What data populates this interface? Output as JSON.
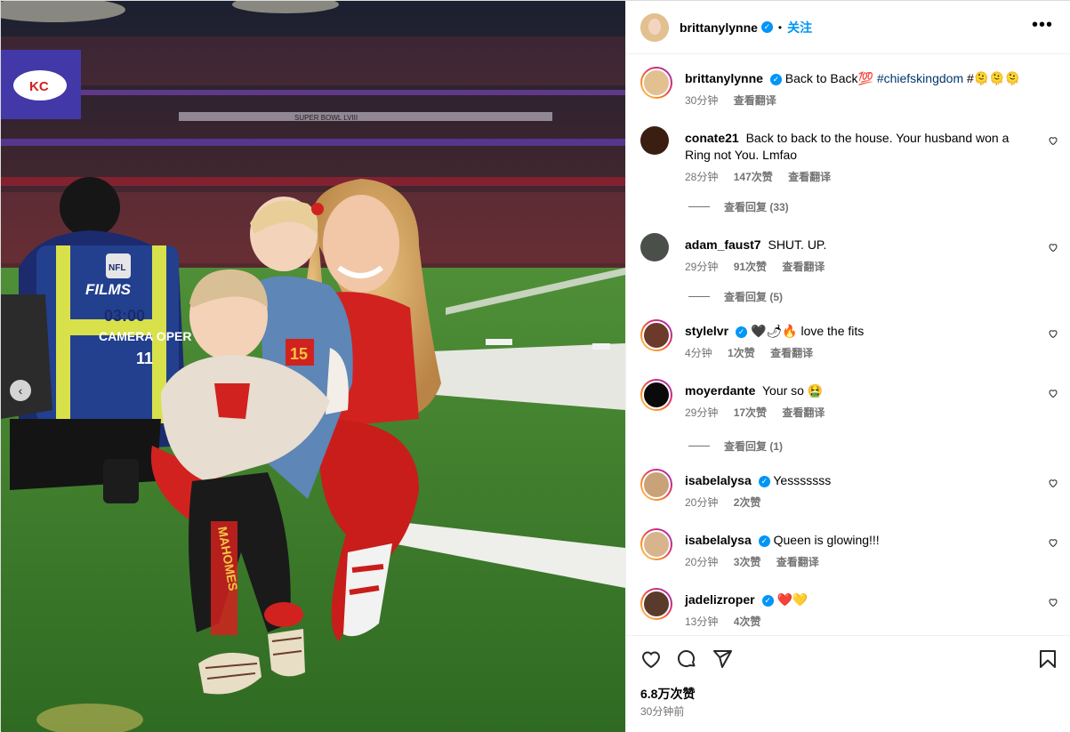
{
  "post": {
    "author": "brittanylynne",
    "follow_label": "关注",
    "more_label": "•••",
    "caption": {
      "text": "Back to Back💯",
      "hashtag": "#chiefskingdom",
      "suffix": "#🫠🫠🫠",
      "time": "30分钟",
      "translate": "查看翻译"
    },
    "likes": "6.8万次赞",
    "posted": "30分钟前"
  },
  "photo": {
    "banner_text": "SUPER BOWL LVIII",
    "vest_line1": "NFL",
    "vest_line2": "FILMS",
    "vest_line3": "03:00",
    "vest_line4": "CAMERA OPER",
    "vest_line5": "11",
    "pants_text": "MAHOMES",
    "jersey_num": "15",
    "prev_arrow": "‹"
  },
  "comments": [
    {
      "user": "conate21",
      "verified": false,
      "text": "Back to back to the house. Your husband won a Ring not You. Lmfao",
      "time": "28分钟",
      "likes": "147次赞",
      "translate": "查看翻译",
      "replies": "查看回复 (33)",
      "avatar_color": "#3a1e12"
    },
    {
      "user": "adam_faust7",
      "verified": false,
      "text": "SHUT. UP.",
      "time": "29分钟",
      "likes": "91次赞",
      "translate": "查看翻译",
      "replies": "查看回复 (5)",
      "avatar_color": "#4b4f4a"
    },
    {
      "user": "stylelvr",
      "verified": true,
      "text": "🖤🌶🔥 love the fits",
      "time": "4分钟",
      "likes": "1次赞",
      "translate": "查看翻译",
      "replies": "",
      "avatar_color": "#6b3a2a"
    },
    {
      "user": "moyerdante",
      "verified": false,
      "text": "Your so 🤮",
      "time": "29分钟",
      "likes": "17次赞",
      "translate": "查看翻译",
      "replies": "查看回复 (1)",
      "avatar_color": "#0a0a0a"
    },
    {
      "user": "isabelalysa",
      "verified": true,
      "text": "Yesssssss",
      "time": "20分钟",
      "likes": "2次赞",
      "translate": "",
      "replies": "",
      "avatar_color": "#c9a27a"
    },
    {
      "user": "isabelalysa",
      "verified": true,
      "text": "Queen is glowing!!!",
      "time": "20分钟",
      "likes": "3次赞",
      "translate": "查看翻译",
      "replies": "",
      "avatar_color": "#d7b48c"
    },
    {
      "user": "jadelizroper",
      "verified": true,
      "text": "❤️💛",
      "time": "13分钟",
      "likes": "4次赞",
      "translate": "",
      "replies": "",
      "avatar_color": "#5a3b2b"
    }
  ],
  "colors": {
    "accent": "#0095f6",
    "chiefs_red": "#d1221f",
    "field_green": "#3f7d2c"
  },
  "icons": [
    "like-icon",
    "comment-icon",
    "share-icon",
    "save-icon",
    "verified-icon",
    "more-options-icon",
    "carousel-prev-icon"
  ]
}
